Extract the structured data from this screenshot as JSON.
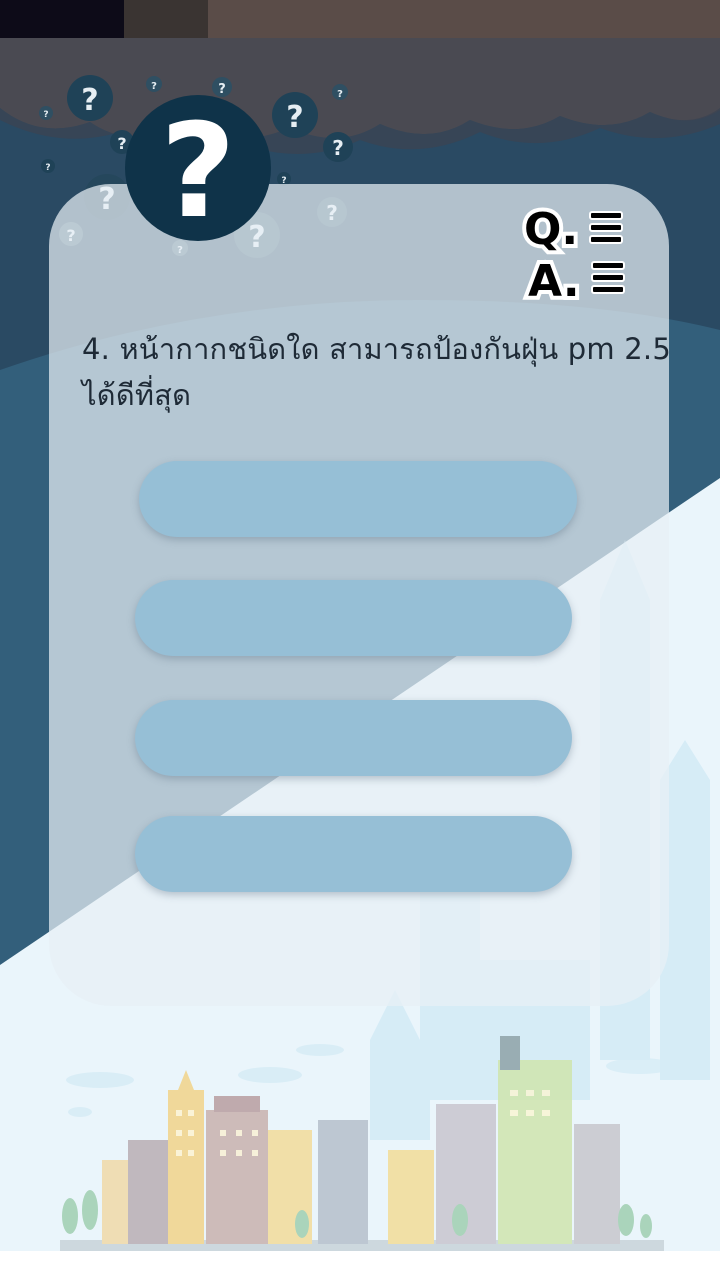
{
  "status_bar": {
    "colors": [
      "#0d0b18",
      "#3a3432",
      "#5a4c48"
    ]
  },
  "header": {
    "icon": "question-mark-icon",
    "logo_text": {
      "q": "Q.",
      "a": "A."
    }
  },
  "quiz": {
    "question": "4. หน้ากากชนิดใด สามารถป้องกันฝุ่น pm 2.5 ได้ดีที่สุด",
    "answers": [
      {
        "label": ""
      },
      {
        "label": ""
      },
      {
        "label": ""
      },
      {
        "label": ""
      }
    ]
  },
  "colors": {
    "sky_dark": "#2a4a63",
    "sky_mid": "#335f7b",
    "answer_button": "#96bfd6",
    "card": "#e8f0f5",
    "question_text": "#1e2a36"
  }
}
